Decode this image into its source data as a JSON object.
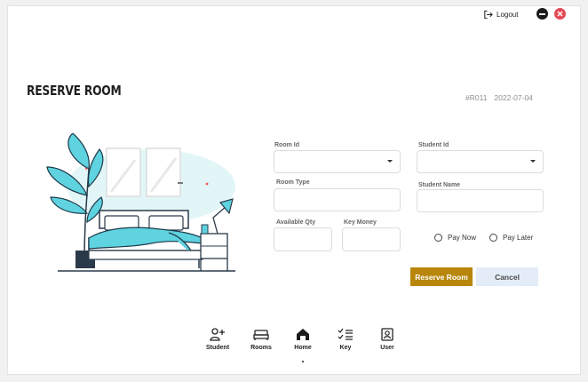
{
  "header": {
    "logout_label": "Logout"
  },
  "page": {
    "title": "RESERVE ROOM",
    "reservation_id": "#R011",
    "date": "2022-07-04"
  },
  "form": {
    "room_id": {
      "label": "Room Id",
      "value": ""
    },
    "room_type": {
      "label": "Room Type",
      "value": ""
    },
    "available_qty": {
      "label": "Available Qty",
      "value": ""
    },
    "key_money": {
      "label": "Key Money",
      "value": ""
    },
    "student_id": {
      "label": "Student Id",
      "value": ""
    },
    "student_name": {
      "label": "Student Name",
      "value": ""
    },
    "payment_options": [
      {
        "label": "Pay Now"
      },
      {
        "label": "Pay Later"
      }
    ]
  },
  "actions": {
    "reserve_label": "Reserve Room",
    "cancel_label": "Cancel"
  },
  "bottom_nav": [
    {
      "label": "Student",
      "icon": "add-user-icon"
    },
    {
      "label": "Rooms",
      "icon": "bed-icon"
    },
    {
      "label": "Home",
      "icon": "home-icon",
      "active": true
    },
    {
      "label": "Key",
      "icon": "checklist-icon"
    },
    {
      "label": "User",
      "icon": "user-portrait-icon"
    }
  ],
  "colors": {
    "accent": "#b8860b",
    "cancel_bg": "#e3ecf7",
    "close": "#e24b55",
    "illustration_teal": "#5fd3e0"
  }
}
